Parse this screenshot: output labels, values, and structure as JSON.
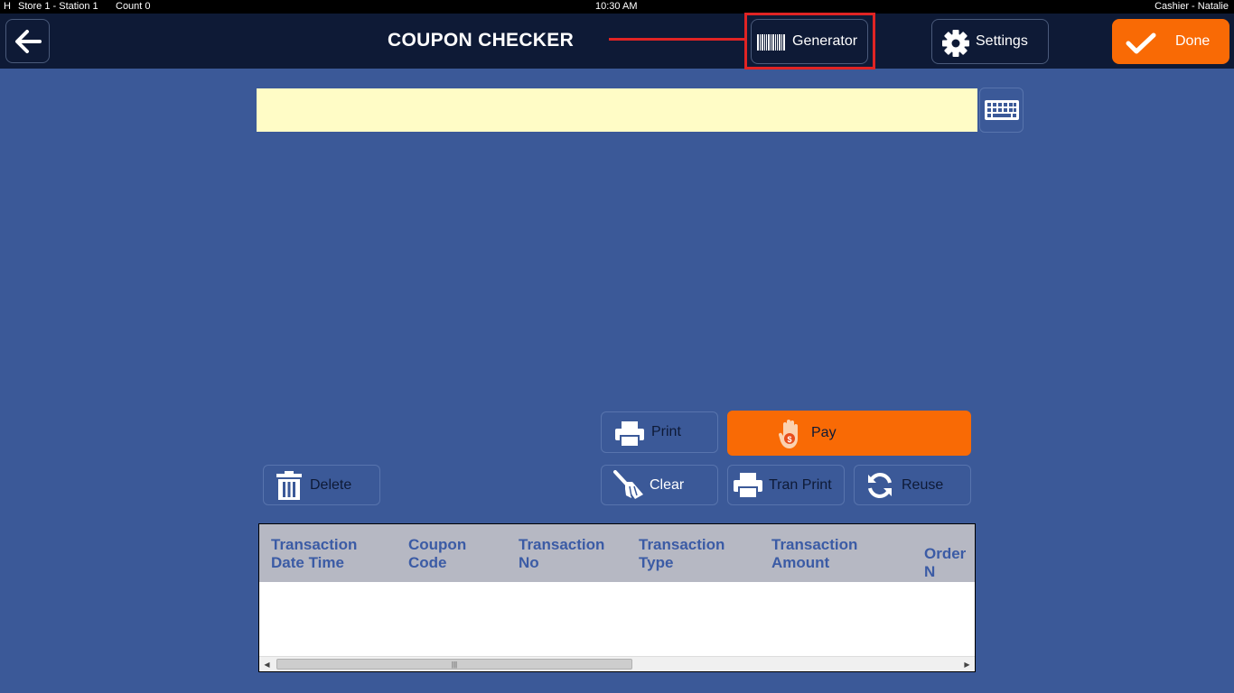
{
  "status": {
    "mode": "H",
    "station": "Store 1 - Station 1",
    "count": "Count 0",
    "time": "10:30 AM",
    "user": "Cashier - Natalie"
  },
  "header": {
    "title": "COUPON CHECKER",
    "generator_label": "Generator",
    "settings_label": "Settings",
    "done_label": "Done"
  },
  "actions": {
    "print": "Print",
    "pay": "Pay",
    "delete": "Delete",
    "clear": "Clear",
    "tran_print": "Tran Print",
    "reuse": "Reuse"
  },
  "table": {
    "columns": [
      "Transaction\nDate Time",
      "Coupon\nCode",
      "Transaction\nNo",
      "Transaction\nType",
      "Transaction\nAmount",
      "Order N"
    ],
    "rows": []
  },
  "colors": {
    "background": "#3b5998",
    "header_bg": "#0e1a36",
    "accent_orange": "#f96a05",
    "highlight_red": "#e02424",
    "input_bg": "#fffcc6"
  }
}
